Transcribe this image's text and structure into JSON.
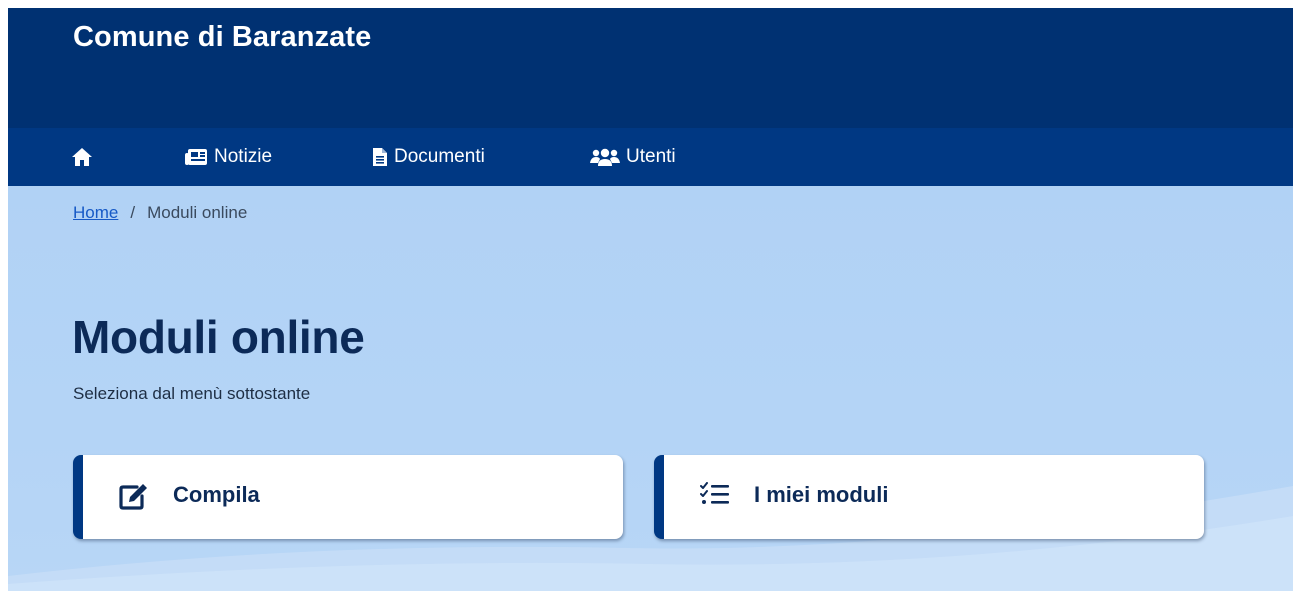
{
  "header": {
    "site_title": "Comune di Baranzate"
  },
  "nav": {
    "items": [
      {
        "label": "",
        "icon": "home-icon"
      },
      {
        "label": "Notizie",
        "icon": "newspaper-icon"
      },
      {
        "label": "Documenti",
        "icon": "file-icon"
      },
      {
        "label": "Utenti",
        "icon": "users-icon"
      }
    ]
  },
  "breadcrumb": {
    "home": "Home",
    "separator": "/",
    "current": "Moduli online"
  },
  "main": {
    "title": "Moduli online",
    "subtitle": "Seleziona dal menù sottostante",
    "cards": [
      {
        "label": "Compila",
        "icon": "edit-icon"
      },
      {
        "label": "I miei moduli",
        "icon": "checklist-icon"
      }
    ]
  },
  "colors": {
    "header_bg": "#003172",
    "nav_bg": "#003883",
    "hero_bg": "#b1d2f5",
    "title_text": "#0c2a58",
    "link": "#1659c6"
  }
}
